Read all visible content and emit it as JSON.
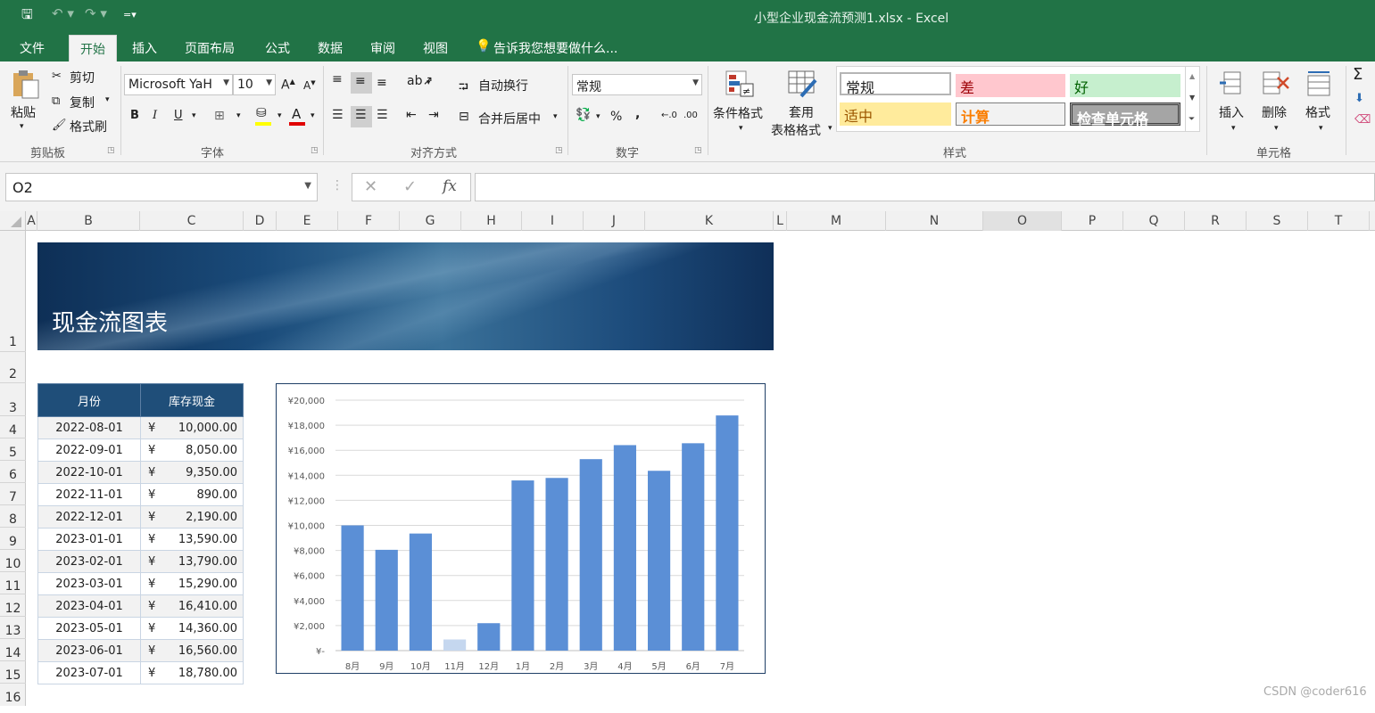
{
  "window": {
    "title": "小型企业现金流预测1.xlsx - Excel"
  },
  "ribbon_tabs": [
    "文件",
    "开始",
    "插入",
    "页面布局",
    "公式",
    "数据",
    "审阅",
    "视图"
  ],
  "active_tab": "开始",
  "tell_me": "告诉我您想要做什么...",
  "clipboard": {
    "paste": "粘贴",
    "cut": "剪切",
    "copy": "复制",
    "format_painter": "格式刷",
    "label": "剪贴板"
  },
  "font": {
    "name": "Microsoft YaH",
    "size": "10",
    "bold": "B",
    "italic": "I",
    "underline": "U",
    "label": "字体"
  },
  "alignment": {
    "wrap": "自动换行",
    "merge": "合并后居中",
    "label": "对齐方式"
  },
  "number": {
    "format": "常规",
    "percent": "%",
    "comma": ",",
    "label": "数字"
  },
  "styles": {
    "conditional": "条件格式",
    "table_format_1": "套用",
    "table_format_2": "表格格式",
    "cells": [
      {
        "label": "常规",
        "bg": "#ffffff",
        "fg": "#000000"
      },
      {
        "label": "差",
        "bg": "#ffc7ce",
        "fg": "#9c0006"
      },
      {
        "label": "好",
        "bg": "#c6efce",
        "fg": "#006100"
      },
      {
        "label": "适中",
        "bg": "#ffeb9c",
        "fg": "#9c5700"
      },
      {
        "label": "计算",
        "bg": "#f2f2f2",
        "fg": "#fa7d00"
      },
      {
        "label": "检查单元格",
        "bg": "#a5a5a5",
        "fg": "#ffffff"
      }
    ],
    "label": "样式"
  },
  "cells_group": {
    "insert": "插入",
    "delete": "删除",
    "format": "格式",
    "label": "单元格"
  },
  "formula_bar": {
    "name_box": "O2",
    "formula": ""
  },
  "columns": [
    "A",
    "B",
    "C",
    "D",
    "E",
    "F",
    "G",
    "H",
    "I",
    "J",
    "K",
    "L",
    "M",
    "N",
    "O",
    "P",
    "Q",
    "R",
    "S",
    "T"
  ],
  "rows": [
    "1",
    "2",
    "3",
    "4",
    "5",
    "6",
    "7",
    "8",
    "9",
    "10",
    "11",
    "12",
    "13",
    "14",
    "15",
    "16"
  ],
  "sheet": {
    "banner_title": "现金流图表",
    "table_headers": [
      "月份",
      "库存现金"
    ],
    "currency": "¥",
    "table_rows": [
      {
        "date": "2022-08-01",
        "amount": "10,000.00"
      },
      {
        "date": "2022-09-01",
        "amount": "8,050.00"
      },
      {
        "date": "2022-10-01",
        "amount": "9,350.00"
      },
      {
        "date": "2022-11-01",
        "amount": "890.00"
      },
      {
        "date": "2022-12-01",
        "amount": "2,190.00"
      },
      {
        "date": "2023-01-01",
        "amount": "13,590.00"
      },
      {
        "date": "2023-02-01",
        "amount": "13,790.00"
      },
      {
        "date": "2023-03-01",
        "amount": "15,290.00"
      },
      {
        "date": "2023-04-01",
        "amount": "16,410.00"
      },
      {
        "date": "2023-05-01",
        "amount": "14,360.00"
      },
      {
        "date": "2023-06-01",
        "amount": "16,560.00"
      },
      {
        "date": "2023-07-01",
        "amount": "18,780.00"
      }
    ]
  },
  "chart_data": {
    "type": "bar",
    "categories": [
      "8月",
      "9月",
      "10月",
      "11月",
      "12月",
      "1月",
      "2月",
      "3月",
      "4月",
      "5月",
      "6月",
      "7月"
    ],
    "values": [
      10000,
      8050,
      9350,
      890,
      2190,
      13590,
      13790,
      15290,
      16410,
      14360,
      16560,
      18780
    ],
    "ylim": [
      0,
      20000
    ],
    "y_ticks": [
      "¥-",
      "¥2,000",
      "¥4,000",
      "¥6,000",
      "¥8,000",
      "¥10,000",
      "¥12,000",
      "¥14,000",
      "¥16,000",
      "¥18,000",
      "¥20,000"
    ],
    "bar_color": "#5b8fd6",
    "highlight_color": "#c5d7ef",
    "highlight_index": 3,
    "grid": true,
    "legend": "none"
  },
  "watermark": "CSDN @coder616"
}
